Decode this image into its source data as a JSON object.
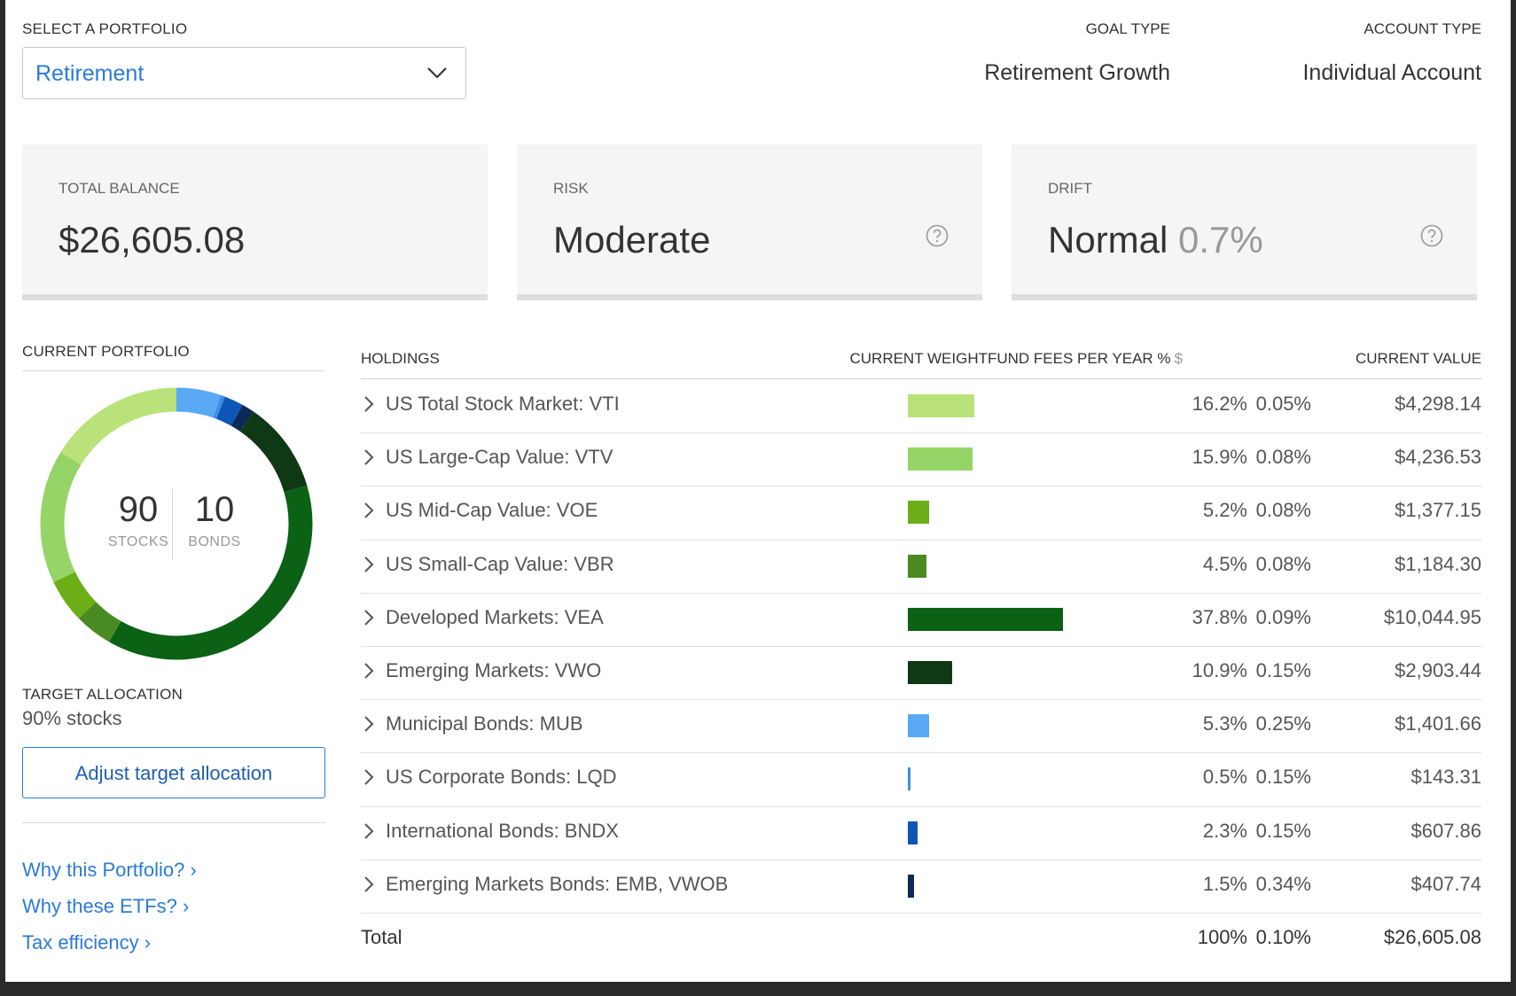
{
  "portfolio_select": {
    "label": "SELECT A PORTFOLIO",
    "value": "Retirement"
  },
  "goal": {
    "label": "GOAL TYPE",
    "value": "Retirement Growth"
  },
  "account": {
    "label": "ACCOUNT TYPE",
    "value": "Individual Account"
  },
  "cards": {
    "balance": {
      "label": "TOTAL BALANCE",
      "value": "$26,605.08"
    },
    "risk": {
      "label": "RISK",
      "value": "Moderate"
    },
    "drift": {
      "label": "DRIFT",
      "value": "Normal",
      "sub": "0.7%"
    }
  },
  "current_portfolio": {
    "label": "CURRENT PORTFOLIO",
    "stocks_value": "90",
    "stocks_label": "STOCKS",
    "bonds_value": "10",
    "bonds_label": "BONDS"
  },
  "target_allocation": {
    "label": "TARGET ALLOCATION",
    "value": "90% stocks",
    "button": "Adjust target allocation"
  },
  "links": [
    "Why this Portfolio? ›",
    "Why these ETFs? ›",
    "Tax efficiency ›"
  ],
  "table": {
    "headers": {
      "holdings": "HOLDINGS",
      "weight": "CURRENT WEIGHT",
      "fees": "FUND FEES PER YEAR %",
      "fees_icon": "$",
      "value": "CURRENT VALUE"
    },
    "rows": [
      {
        "name": "US Total Stock Market: VTI",
        "weight": "16.2%",
        "weight_num": 16.2,
        "color": "#b9e27a",
        "fee": "0.05%",
        "value": "$4,298.14"
      },
      {
        "name": "US Large-Cap Value: VTV",
        "weight": "15.9%",
        "weight_num": 15.9,
        "color": "#95d467",
        "fee": "0.08%",
        "value": "$4,236.53"
      },
      {
        "name": "US Mid-Cap Value: VOE",
        "weight": "5.2%",
        "weight_num": 5.2,
        "color": "#6cae17",
        "fee": "0.08%",
        "value": "$1,377.15"
      },
      {
        "name": "US Small-Cap Value: VBR",
        "weight": "4.5%",
        "weight_num": 4.5,
        "color": "#4a8a22",
        "fee": "0.08%",
        "value": "$1,184.30"
      },
      {
        "name": "Developed Markets: VEA",
        "weight": "37.8%",
        "weight_num": 37.8,
        "color": "#0b6114",
        "fee": "0.09%",
        "value": "$10,044.95"
      },
      {
        "name": "Emerging Markets: VWO",
        "weight": "10.9%",
        "weight_num": 10.9,
        "color": "#0f3815",
        "fee": "0.15%",
        "value": "$2,903.44"
      },
      {
        "name": "Municipal Bonds: MUB",
        "weight": "5.3%",
        "weight_num": 5.3,
        "color": "#5aa9f5",
        "fee": "0.25%",
        "value": "$1,401.66"
      },
      {
        "name": "US Corporate Bonds: LQD",
        "weight": "0.5%",
        "weight_num": 0.5,
        "color": "#3b8fe6",
        "fee": "0.15%",
        "value": "$143.31"
      },
      {
        "name": "International Bonds: BNDX",
        "weight": "2.3%",
        "weight_num": 2.3,
        "color": "#0d56b5",
        "fee": "0.15%",
        "value": "$607.86"
      },
      {
        "name": "Emerging Markets Bonds: EMB, VWOB",
        "weight": "1.5%",
        "weight_num": 1.5,
        "color": "#0b2a55",
        "fee": "0.34%",
        "value": "$407.74"
      }
    ],
    "total": {
      "label": "Total",
      "weight": "100%",
      "fee": "0.10%",
      "value": "$26,605.08"
    }
  },
  "donut_segments": [
    {
      "name": "Municipal Bonds",
      "pct": 5.3,
      "color": "#5aa9f5"
    },
    {
      "name": "US Corporate Bonds",
      "pct": 0.5,
      "color": "#3b8fe6"
    },
    {
      "name": "International Bonds",
      "pct": 2.3,
      "color": "#0d56b5"
    },
    {
      "name": "Emerging Markets Bonds",
      "pct": 1.5,
      "color": "#0b2a55"
    },
    {
      "name": "Emerging Markets",
      "pct": 10.9,
      "color": "#0f3815"
    },
    {
      "name": "Developed Markets",
      "pct": 37.8,
      "color": "#0b6114"
    },
    {
      "name": "US Small-Cap Value",
      "pct": 4.5,
      "color": "#4a8a22"
    },
    {
      "name": "US Mid-Cap Value",
      "pct": 5.2,
      "color": "#6cae17"
    },
    {
      "name": "US Large-Cap Value",
      "pct": 15.9,
      "color": "#95d467"
    },
    {
      "name": "US Total Stock Market",
      "pct": 16.2,
      "color": "#b9e27a"
    }
  ]
}
